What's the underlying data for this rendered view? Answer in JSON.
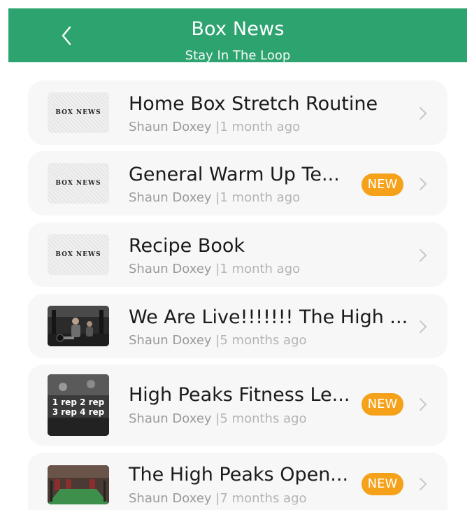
{
  "header": {
    "title": "Box News",
    "subtitle": "Stay In The Loop",
    "accent_color": "#2da36f",
    "back_icon": "chevron-left-icon"
  },
  "colors": {
    "badge": "#f5a119",
    "card_bg": "#f7f7f7",
    "meta": "#b4b4b4"
  },
  "news": [
    {
      "title": "Home Box Stretch Routine",
      "author": "Shaun Doxey",
      "separator": "|",
      "time": "1 month ago",
      "thumb_text": "BOX NEWS",
      "badge": ""
    },
    {
      "title": "General Warm Up Te...",
      "author": "Shaun Doxey",
      "separator": "|",
      "time": "1 month ago",
      "thumb_text": "BOX NEWS",
      "badge": "NEW"
    },
    {
      "title": "Recipe Book",
      "author": "Shaun Doxey",
      "separator": "|",
      "time": "1 month ago",
      "thumb_text": "BOX NEWS",
      "badge": ""
    },
    {
      "title": "We Are Live!!!!!!! The High ...",
      "author": "Shaun Doxey",
      "separator": "|",
      "time": "5 months ago",
      "thumb_text": "",
      "badge": ""
    },
    {
      "title": "High Peaks Fitness Le...",
      "author": "Shaun Doxey",
      "separator": "|",
      "time": "5 months ago",
      "thumb_text": "1 rep 2 rep 3 rep 4 rep",
      "badge": "NEW"
    },
    {
      "title": "The High Peaks Open...",
      "author": "Shaun Doxey",
      "separator": "|",
      "time": "7 months ago",
      "thumb_text": "",
      "badge": "NEW"
    }
  ]
}
